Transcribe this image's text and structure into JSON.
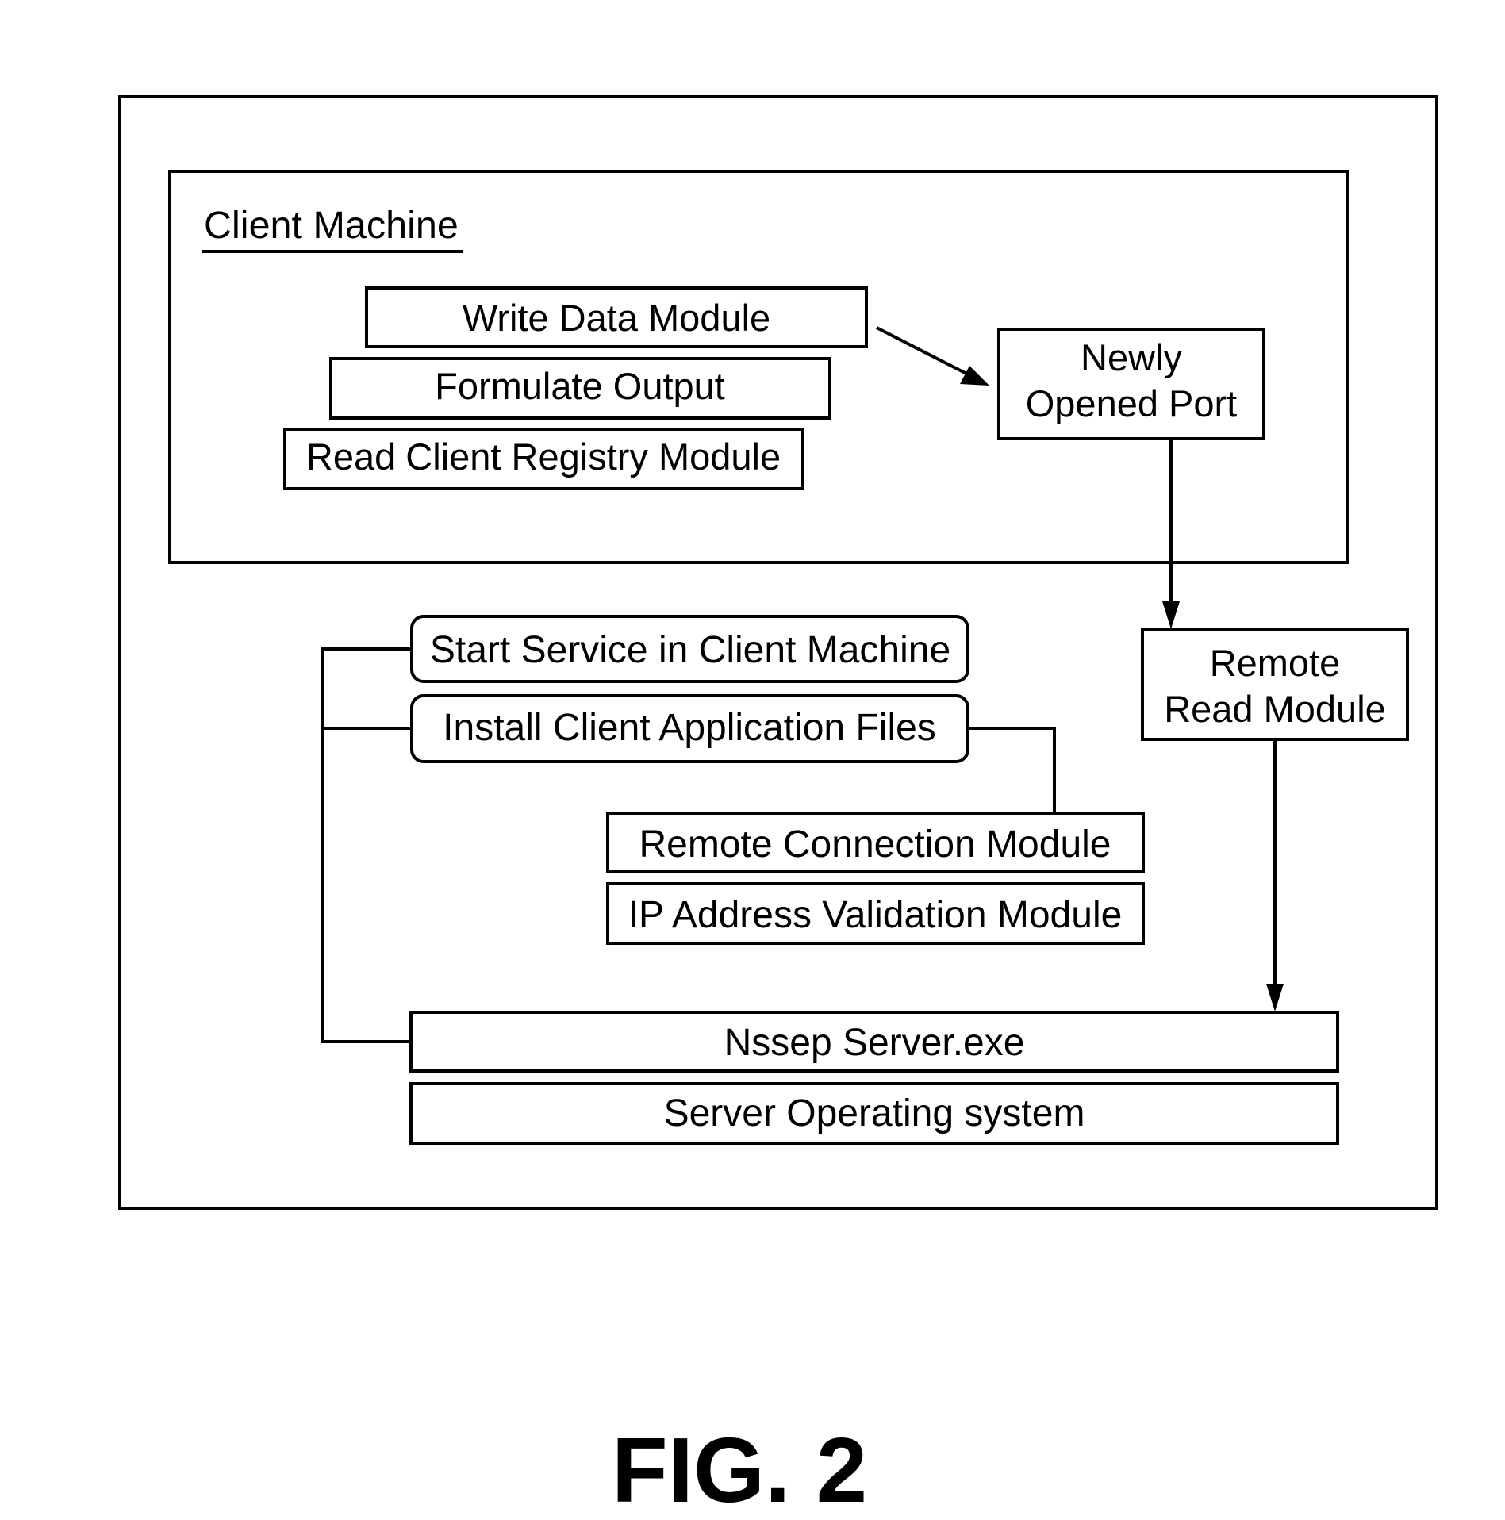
{
  "figure": {
    "label": "FIG. 2"
  },
  "client_machine": {
    "title": "Client Machine",
    "modules": {
      "write_data": "Write Data Module",
      "formulate_output": "Formulate Output",
      "read_client_registry": "Read Client Registry Module"
    },
    "port": {
      "line1": "Newly",
      "line2": "Opened Port"
    }
  },
  "server": {
    "remote_read": {
      "line1": "Remote",
      "line2": "Read Module"
    },
    "actions": {
      "start_service": "Start Service in Client Machine",
      "install_files": "Install Client Application Files"
    },
    "modules": {
      "remote_connection": "Remote Connection Module",
      "ip_validation": "IP Address Validation Module"
    },
    "executable": "Nssep Server.exe",
    "operating_system": "Server Operating system"
  },
  "colors": {
    "stroke": "#000000",
    "background": "#ffffff"
  }
}
